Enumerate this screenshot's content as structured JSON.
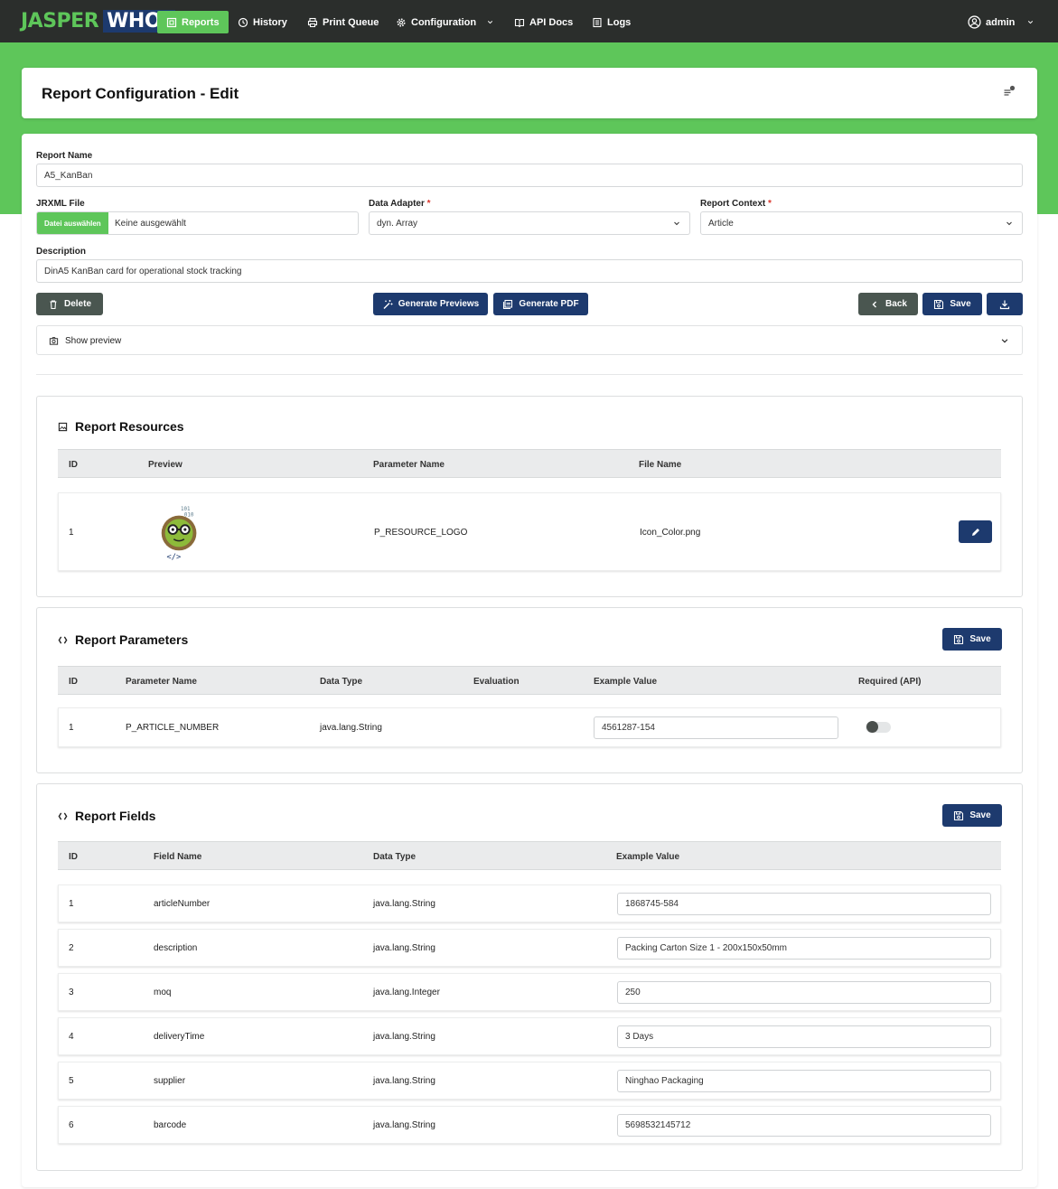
{
  "nav": {
    "logo_part1": "JASPER",
    "logo_part2": "WHO?",
    "items": [
      {
        "label": "Reports",
        "icon": "report-icon"
      },
      {
        "label": "History",
        "icon": "history-icon"
      },
      {
        "label": "Print Queue",
        "icon": "printer-icon"
      },
      {
        "label": "Configuration",
        "icon": "gear-icon"
      },
      {
        "label": "API Docs",
        "icon": "book-icon"
      },
      {
        "label": "Logs",
        "icon": "list-icon"
      }
    ],
    "user": "admin"
  },
  "colors": {
    "brand_green": "#5ec65a",
    "navy": "#1d3a6e",
    "nav_bg": "#2b2e2c",
    "gray_button": "#4a5650"
  },
  "page": {
    "title": "Report Configuration - Edit"
  },
  "form": {
    "report_name_label": "Report Name",
    "report_name_value": "A5_KanBan",
    "jrxml_label": "JRXML File",
    "file_button": "Datei auswählen",
    "file_status": "Keine ausgewählt",
    "data_adapter_label": "Data Adapter",
    "data_adapter_value": "dyn. Array",
    "report_context_label": "Report Context",
    "report_context_value": "Article",
    "required_marker": "*",
    "description_label": "Description",
    "description_value": "DinA5 KanBan card for operational stock tracking"
  },
  "actions": {
    "delete": "Delete",
    "generate_previews": "Generate Previews",
    "generate_pdf": "Generate PDF",
    "back": "Back",
    "save": "Save"
  },
  "preview": {
    "label": "Show preview"
  },
  "resources": {
    "title": "Report Resources",
    "columns": [
      "ID",
      "Preview",
      "Parameter Name",
      "File Name"
    ],
    "rows": [
      {
        "id": "1",
        "parameter_name": "P_RESOURCE_LOGO",
        "file_name": "Icon_Color.png"
      }
    ]
  },
  "parameters": {
    "title": "Report Parameters",
    "save": "Save",
    "columns": [
      "ID",
      "Parameter Name",
      "Data Type",
      "Evaluation",
      "Example Value",
      "Required (API)"
    ],
    "rows": [
      {
        "id": "1",
        "name": "P_ARTICLE_NUMBER",
        "type": "java.lang.String",
        "evaluation": "",
        "example": "4561287-154",
        "required": false
      }
    ]
  },
  "fields": {
    "title": "Report Fields",
    "save": "Save",
    "columns": [
      "ID",
      "Field Name",
      "Data Type",
      "Example Value"
    ],
    "rows": [
      {
        "id": "1",
        "name": "articleNumber",
        "type": "java.lang.String",
        "example": "1868745-584"
      },
      {
        "id": "2",
        "name": "description",
        "type": "java.lang.String",
        "example": "Packing Carton Size 1 - 200x150x50mm"
      },
      {
        "id": "3",
        "name": "moq",
        "type": "java.lang.Integer",
        "example": "250"
      },
      {
        "id": "4",
        "name": "deliveryTime",
        "type": "java.lang.String",
        "example": "3 Days"
      },
      {
        "id": "5",
        "name": "supplier",
        "type": "java.lang.String",
        "example": "Ninghao Packaging"
      },
      {
        "id": "6",
        "name": "barcode",
        "type": "java.lang.String",
        "example": "5698532145712"
      }
    ]
  }
}
